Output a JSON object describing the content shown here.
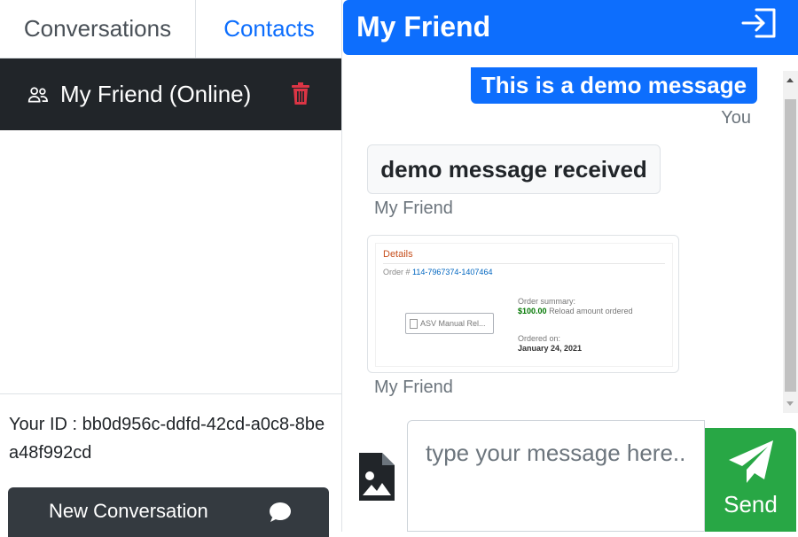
{
  "tabs": {
    "conversations": "Conversations",
    "contacts": "Contacts"
  },
  "conversation_list": [
    {
      "name": "My Friend (Online)"
    }
  ],
  "identity": {
    "your_id_text": "Your ID : bb0d956c-ddfd-42cd-a0c8-8bea48f992cd"
  },
  "new_conversation_label": "New Conversation",
  "chat": {
    "title": "My Friend",
    "messages": [
      {
        "text": "This is a demo message",
        "sender": "You"
      },
      {
        "text": "demo message received",
        "sender": "My Friend"
      },
      {
        "sender": "My Friend",
        "image": {
          "heading": "Details",
          "order_label": "Order #",
          "order_number": "114-7967374-1407464",
          "button_text": "ASV Manual Rel...",
          "summary_label": "Order summary:",
          "amount": "$100.00",
          "amount_note": "Reload amount ordered",
          "ordered_on_label": "Ordered on:",
          "ordered_on_date": "January 24, 2021"
        }
      }
    ]
  },
  "composer": {
    "placeholder": "type your message here..",
    "send_label": "Send"
  },
  "colors": {
    "primary": "#0d6efd",
    "dark": "#212529",
    "send_green": "#28a745",
    "delete_red": "#dc3545"
  }
}
